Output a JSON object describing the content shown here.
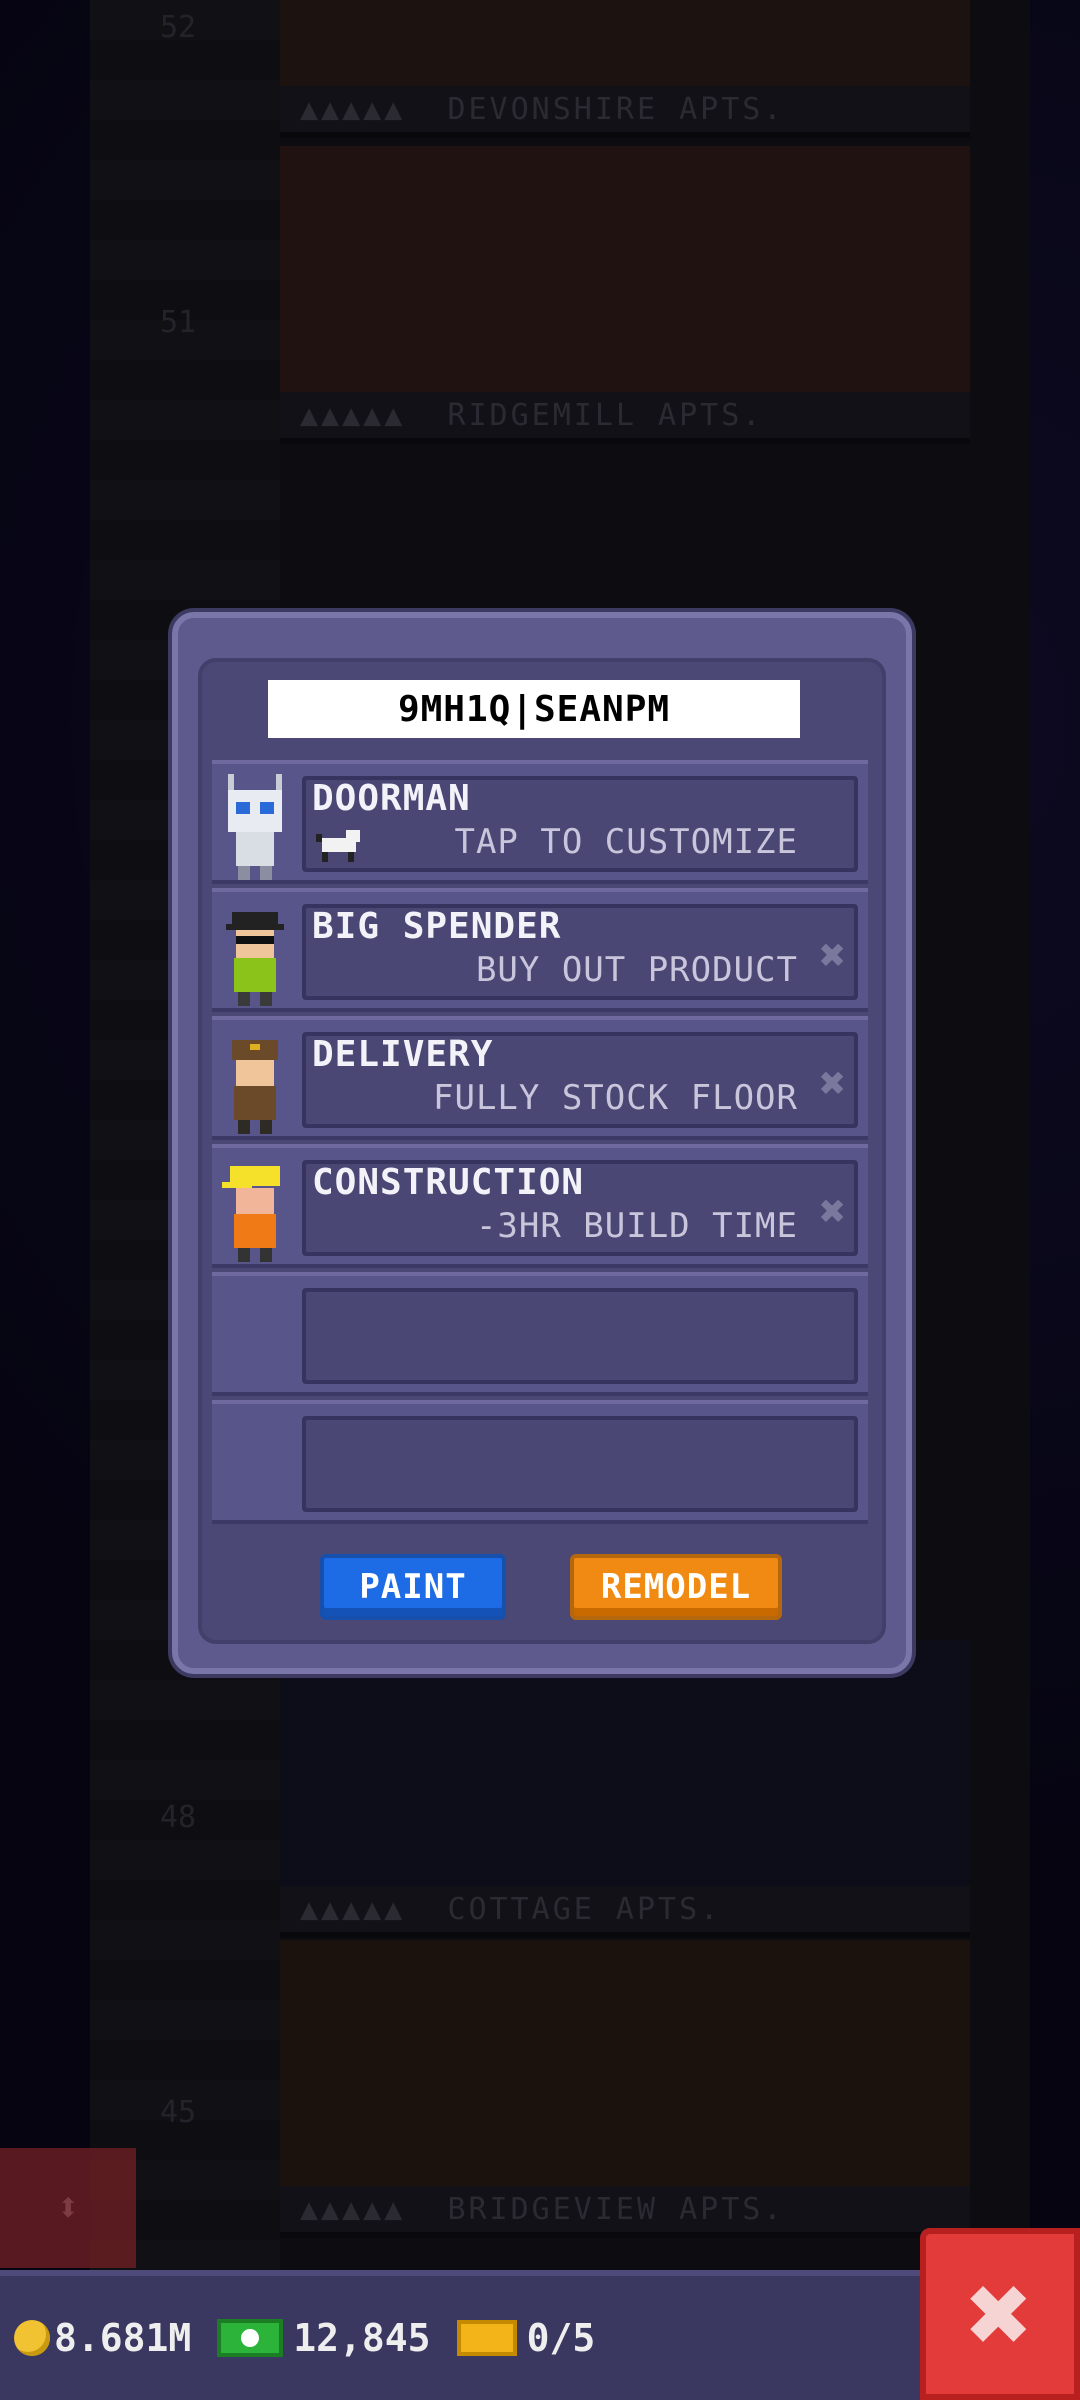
{
  "background": {
    "floors": [
      {
        "number": "52",
        "name": "DEVONSHIRE APTS."
      },
      {
        "number": "51",
        "name": "RIDGEMILL APTS."
      },
      {
        "number": "48",
        "name": "COTTAGE APTS."
      },
      {
        "number": "45",
        "name": "BRIDGEVIEW APTS."
      }
    ]
  },
  "modal": {
    "name_value": "9MH1Q|SEANPM",
    "slots": [
      {
        "title": "DOORMAN",
        "desc": "TAP TO CUSTOMIZE",
        "icon": "robot-doorman-icon",
        "removable": false
      },
      {
        "title": "BIG SPENDER",
        "desc": "BUY OUT PRODUCT",
        "icon": "big-spender-icon",
        "removable": true
      },
      {
        "title": "DELIVERY",
        "desc": "FULLY STOCK FLOOR",
        "icon": "delivery-worker-icon",
        "removable": true
      },
      {
        "title": "CONSTRUCTION",
        "desc": "-3HR BUILD TIME",
        "icon": "construction-worker-icon",
        "removable": true
      },
      {
        "title": "",
        "desc": ""
      },
      {
        "title": "",
        "desc": ""
      }
    ],
    "remove_glyph": "✖",
    "paint_label": "PAINT",
    "remodel_label": "REMODEL",
    "colors": {
      "paint": "#1e6be6",
      "remodel": "#f08a12"
    }
  },
  "bottom_bar": {
    "coins": "8.681M",
    "bux": "12,845",
    "tickets": "0/5"
  },
  "close_glyph": "✖",
  "elevator_glyph": "⬍"
}
